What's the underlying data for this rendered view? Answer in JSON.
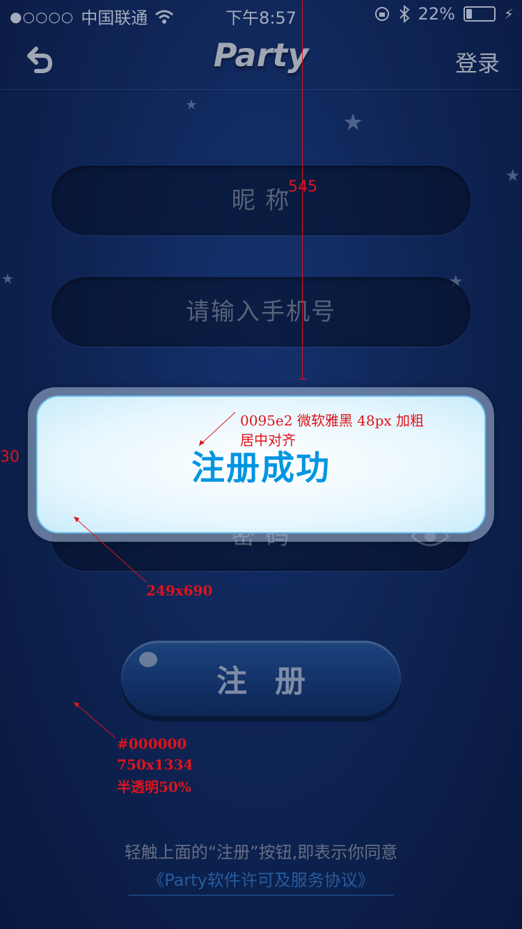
{
  "status": {
    "signal": "●○○○○",
    "carrier": "中国联通",
    "time": "下午8:57",
    "battery": "22%",
    "battery_level": 0.22
  },
  "nav": {
    "title": "Party",
    "login_label": "登录"
  },
  "form": {
    "nickname_placeholder": "昵 称",
    "phone_placeholder": "请输入手机号",
    "password_placeholder": "密 码",
    "register_label": "注册"
  },
  "footer": {
    "agree_text": "轻触上面的“注册”按钮,即表示你同意",
    "agreement_link": "《Party软件许可及服务协议》"
  },
  "dialog": {
    "message": "注册成功",
    "accent_color": "#0095e2"
  },
  "annotations": {
    "vertical_measure": "545",
    "side_measure": "30",
    "font_note_1": "0095e2 微软雅黑 48px 加粗",
    "font_note_2": "居中对齐",
    "dialog_size_note": "249x690",
    "overlay_color_note": "#000000",
    "overlay_size_note": "750x1334",
    "overlay_opacity_note": "半透明50%"
  }
}
